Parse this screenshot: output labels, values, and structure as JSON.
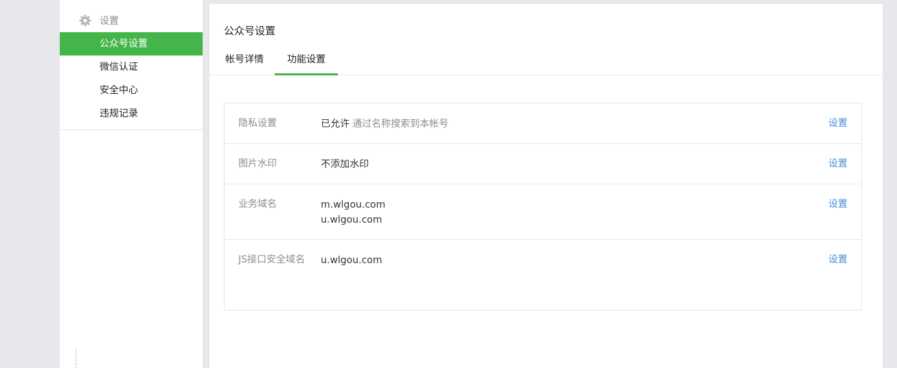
{
  "sidebar": {
    "group_title": "设置",
    "group_icon": "gear-icon",
    "items": [
      {
        "label": "公众号设置",
        "active": true
      },
      {
        "label": "微信认证",
        "active": false
      },
      {
        "label": "安全中心",
        "active": false
      },
      {
        "label": "违规记录",
        "active": false
      }
    ]
  },
  "main": {
    "title": "公众号设置",
    "tabs": [
      {
        "label": "帐号详情",
        "active": false
      },
      {
        "label": "功能设置",
        "active": true
      }
    ],
    "settings": [
      {
        "label": "隐私设置",
        "value": "已允许",
        "sub": "通过名称搜索到本帐号",
        "action": "设置"
      },
      {
        "label": "图片水印",
        "value": "不添加水印",
        "action": "设置"
      },
      {
        "label": "业务域名",
        "value_lines": [
          "m.wlgou.com",
          "u.wlgou.com"
        ],
        "action": "设置"
      },
      {
        "label": "JS接口安全域名",
        "value": "u.wlgou.com",
        "action": "设置"
      }
    ]
  },
  "colors": {
    "accent": "#44b549",
    "link": "#4a90d9",
    "muted": "#8d8d8d",
    "background": "#e7e8eb"
  }
}
